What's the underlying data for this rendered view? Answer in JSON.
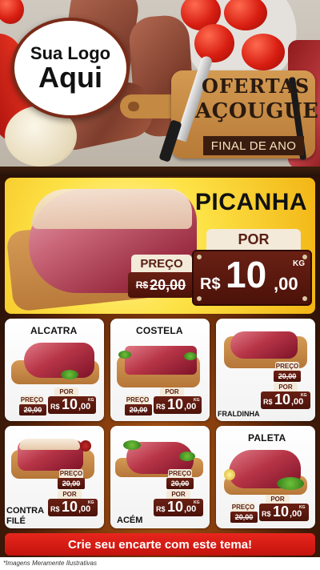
{
  "logo": {
    "line1": "Sua Logo",
    "line2": "Aqui"
  },
  "header": {
    "title_line1": "OFERTAS",
    "title_line2": "AÇOUGUE",
    "ribbon": "FINAL DE ANO"
  },
  "featured": {
    "name": "PICANHA",
    "por_label": "POR",
    "currency": "R$",
    "price_int": "10",
    "price_dec": ",00",
    "unit": "KG",
    "preco_label": "PREÇO",
    "old_currency": "R$",
    "old_price": "20,00"
  },
  "products": [
    {
      "name": "ALCATRA",
      "preco_label": "PREÇO",
      "old_price": "20,00",
      "por_label": "POR",
      "currency": "R$",
      "price_int": "10",
      "price_dec": ",00",
      "unit": "KG"
    },
    {
      "name": "COSTELA",
      "preco_label": "PREÇO",
      "old_price": "20,00",
      "por_label": "POR",
      "currency": "R$",
      "price_int": "10",
      "price_dec": ",00",
      "unit": "KG"
    },
    {
      "name": "FRALDINHA",
      "preco_label": "PREÇO",
      "old_price": "20,00",
      "por_label": "POR",
      "currency": "R$",
      "price_int": "10",
      "price_dec": ",00",
      "unit": "KG"
    },
    {
      "name_line1": "CONTRA",
      "name_line2": "FILÉ",
      "preco_label": "PREÇO",
      "old_price": "20,00",
      "por_label": "POR",
      "currency": "R$",
      "price_int": "10",
      "price_dec": ",00",
      "unit": "KG"
    },
    {
      "name": "ACÉM",
      "preco_label": "PREÇO",
      "old_price": "20,00",
      "por_label": "POR",
      "currency": "R$",
      "price_int": "10",
      "price_dec": ",00",
      "unit": "KG"
    },
    {
      "name": "PALETA",
      "preco_label": "PREÇO",
      "old_price": "20,00",
      "por_label": "POR",
      "currency": "R$",
      "price_int": "10",
      "price_dec": ",00",
      "unit": "KG"
    }
  ],
  "cta": {
    "label": "Crie seu encarte com este tema!"
  },
  "footer": {
    "disclaimer": "*Imagens Meramente Ilustrativas"
  },
  "colors": {
    "accent_red": "#c2130d",
    "price_box": "#5a1a10",
    "feature_yellow": "#fde246"
  }
}
